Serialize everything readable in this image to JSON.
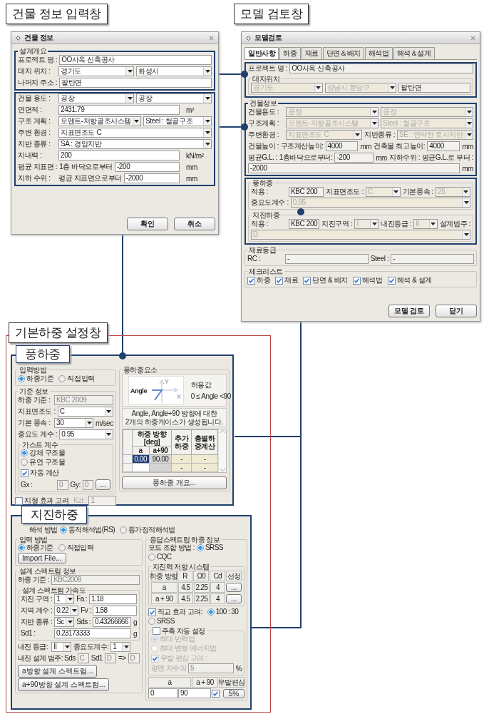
{
  "callouts": [
    "건물 정보 입력창",
    "모델 검토창"
  ],
  "building_window": {
    "title": "건물 정보",
    "blocks": [
      {
        "kind": "group",
        "legend": "설계개요",
        "highlighted": true,
        "blocks": [
          {
            "kind": "row",
            "items": [
              {
                "kind": "label",
                "text": "프로젝트 명 :"
              },
              {
                "kind": "input",
                "value": "OO사옥 신축공사"
              }
            ]
          },
          {
            "kind": "row",
            "items": [
              {
                "kind": "label",
                "text": "대지 위치 :"
              },
              {
                "kind": "select",
                "value": "경기도"
              },
              {
                "kind": "select",
                "value": "화성시"
              }
            ]
          },
          {
            "kind": "row",
            "items": [
              {
                "kind": "label",
                "text": "나머지 주소 :"
              },
              {
                "kind": "input",
                "value": "팔탄면"
              }
            ]
          }
        ]
      },
      {
        "kind": "group",
        "highlighted": true,
        "blocks": [
          {
            "kind": "row",
            "items": [
              {
                "kind": "label",
                "text": "건물 용도 :"
              },
              {
                "kind": "select",
                "value": "공장"
              },
              {
                "kind": "select",
                "value": "공장"
              }
            ]
          },
          {
            "kind": "row",
            "items": [
              {
                "kind": "label",
                "text": "연면적 :"
              },
              {
                "kind": "input",
                "value": "2431.79"
              },
              {
                "kind": "unit",
                "text": "m²"
              }
            ]
          },
          {
            "kind": "row",
            "items": [
              {
                "kind": "label",
                "text": "구조 계획 :"
              },
              {
                "kind": "select",
                "value": "모멘트-저항골조시스템"
              },
              {
                "kind": "select",
                "value": "Steel : 철골구조"
              }
            ]
          },
          {
            "kind": "row",
            "items": [
              {
                "kind": "label",
                "text": "주변 환경 :"
              },
              {
                "kind": "select",
                "value": "지표면조도 C"
              }
            ]
          },
          {
            "kind": "row",
            "items": [
              {
                "kind": "label",
                "text": "지반 종류 :"
              },
              {
                "kind": "select",
                "value": "SA : 경암지반"
              }
            ]
          },
          {
            "kind": "row",
            "items": [
              {
                "kind": "label",
                "text": "지내력 :"
              },
              {
                "kind": "input",
                "value": "200"
              },
              {
                "kind": "unit",
                "text": "kN/m²"
              }
            ]
          },
          {
            "kind": "row",
            "items": [
              {
                "kind": "label",
                "text": "평균 지표면 :"
              },
              {
                "kind": "label",
                "text": "1층 바닥으로부터"
              },
              {
                "kind": "input",
                "value": "-200"
              },
              {
                "kind": "unit",
                "text": "mm"
              }
            ]
          },
          {
            "kind": "row",
            "items": [
              {
                "kind": "label",
                "text": "지하 수위 :"
              },
              {
                "kind": "label",
                "text": "평균 지표면으로부터"
              },
              {
                "kind": "input",
                "value": "-2000"
              },
              {
                "kind": "unit",
                "text": "mm"
              }
            ]
          }
        ]
      }
    ],
    "buttons": [
      "확인",
      "취소"
    ]
  },
  "review_window": {
    "title": "모델검토",
    "tabs": [
      {
        "label": "일반사항",
        "selected": true
      },
      {
        "label": "하중",
        "selected": false
      },
      {
        "label": "재료",
        "selected": false
      },
      {
        "label": "단면＆배치",
        "selected": false
      },
      {
        "label": "해석법",
        "selected": false
      },
      {
        "label": "해석＆설계",
        "selected": false
      }
    ],
    "blocks": [
      {
        "kind": "group",
        "highlighted": true,
        "blocks": [
          {
            "kind": "row",
            "items": [
              {
                "kind": "label",
                "text": "프로젝트 명 :"
              },
              {
                "kind": "input",
                "value": "OO사옥 신축공사"
              }
            ]
          },
          {
            "kind": "group",
            "legend": "대지위치",
            "highlighted": false,
            "blocks": [
              {
                "kind": "row",
                "items": [
                  {
                    "kind": "select",
                    "value": "경기도",
                    "disabled": true
                  },
                  {
                    "kind": "select",
                    "value": "성남시 분당구",
                    "disabled": true
                  },
                  {
                    "kind": "input",
                    "value": "팔탄면"
                  }
                ]
              }
            ]
          }
        ]
      },
      {
        "kind": "group",
        "legend": "건물정보",
        "highlighted": true,
        "blocks": [
          {
            "kind": "row",
            "items": [
              {
                "kind": "label",
                "text": "건물용도 :"
              },
              {
                "kind": "select",
                "value": "공장",
                "disabled": true
              },
              {
                "kind": "select",
                "value": "공장",
                "disabled": true
              }
            ]
          },
          {
            "kind": "row",
            "items": [
              {
                "kind": "label",
                "text": "구조계획 :"
              },
              {
                "kind": "select",
                "value": "모멘트-저항골조시스템",
                "disabled": true
              },
              {
                "kind": "select",
                "value": "Steel : 철골구조",
                "disabled": true
              }
            ]
          },
          {
            "kind": "row",
            "items": [
              {
                "kind": "label",
                "text": "주변환경 :"
              },
              {
                "kind": "select",
                "value": "지표면조도 C",
                "disabled": true
              },
              {
                "kind": "label",
                "text": "지반종류 :"
              },
              {
                "kind": "select",
                "value": "SE : 연약한 토사지반",
                "disabled": true
              }
            ]
          },
          {
            "kind": "row",
            "items": [
              {
                "kind": "label",
                "text": "건물높이 : 구조계산높이:"
              },
              {
                "kind": "input",
                "value": "4000"
              },
              {
                "kind": "unit",
                "text": "mm"
              },
              {
                "kind": "label",
                "text": "건축물 최고높이:"
              },
              {
                "kind": "input",
                "value": "4000"
              },
              {
                "kind": "unit",
                "text": "mm"
              }
            ]
          },
          {
            "kind": "row",
            "items": [
              {
                "kind": "label",
                "text": "평균G.L. : 1층바닥으로부터:"
              },
              {
                "kind": "input",
                "value": "-200"
              },
              {
                "kind": "unit",
                "text": "mm"
              },
              {
                "kind": "label",
                "text": "지하수위 : 평균G.L.로 부터 :"
              },
              {
                "kind": "input",
                "value": "-2000"
              },
              {
                "kind": "unit",
                "text": "mm"
              }
            ]
          }
        ]
      },
      {
        "kind": "group",
        "highlighted": true,
        "blocks": [
          {
            "kind": "group",
            "legend": "풍하중",
            "highlighted": false,
            "blocks": [
              {
                "kind": "row",
                "items": [
                  {
                    "kind": "label",
                    "text": "적용 :"
                  },
                  {
                    "kind": "input",
                    "value": "KBC 200"
                  },
                  {
                    "kind": "label",
                    "text": "지표면조도 :"
                  },
                  {
                    "kind": "select",
                    "value": "C",
                    "disabled": true
                  },
                  {
                    "kind": "label",
                    "text": "기본풍속 :"
                  },
                  {
                    "kind": "select",
                    "value": "25",
                    "disabled": true
                  },
                  {
                    "kind": "label",
                    "text": "중요도계수 :"
                  },
                  {
                    "kind": "select",
                    "value": "0.95",
                    "disabled": true
                  }
                ]
              }
            ]
          },
          {
            "kind": "group",
            "legend": "지진하중",
            "highlighted": false,
            "blocks": [
              {
                "kind": "row",
                "items": [
                  {
                    "kind": "label",
                    "text": "적용 :"
                  },
                  {
                    "kind": "input",
                    "value": "KBC 200"
                  },
                  {
                    "kind": "label",
                    "text": "지진구역 :"
                  },
                  {
                    "kind": "select",
                    "value": "I",
                    "disabled": true
                  },
                  {
                    "kind": "label",
                    "text": "내진등급 :"
                  },
                  {
                    "kind": "select",
                    "value": "II",
                    "disabled": true
                  },
                  {
                    "kind": "label",
                    "text": "설계범주 :"
                  },
                  {
                    "kind": "select",
                    "value": "D",
                    "disabled": true
                  }
                ]
              }
            ]
          }
        ]
      },
      {
        "kind": "group",
        "legend": "재료등급",
        "highlighted": false,
        "blocks": [
          {
            "kind": "row",
            "items": [
              {
                "kind": "label",
                "text": "RC :"
              },
              {
                "kind": "input",
                "value": "-"
              },
              {
                "kind": "label",
                "text": "Steel :"
              },
              {
                "kind": "input",
                "value": "-"
              }
            ]
          }
        ]
      },
      {
        "kind": "group",
        "legend": "체크리스트",
        "highlighted": false,
        "blocks": [
          {
            "kind": "row",
            "items": [
              {
                "kind": "check",
                "text": "하중",
                "checked": true
              },
              {
                "kind": "check",
                "text": "재료",
                "checked": true
              },
              {
                "kind": "check",
                "text": "단면 & 배치",
                "checked": true
              },
              {
                "kind": "check",
                "text": "해석법",
                "checked": true
              },
              {
                "kind": "check",
                "text": "해석 & 설계",
                "checked": true
              }
            ]
          }
        ]
      }
    ],
    "buttons": [
      "모델 검토",
      "닫기"
    ]
  },
  "load_settings": {
    "label": "기본하중 설정창",
    "wind": {
      "label": "풍하중",
      "columns": [
        [
          {
            "kind": "group",
            "legend": "입력방법",
            "highlighted": false,
            "blocks": [
              {
                "kind": "row",
                "items": [
                  {
                    "kind": "radio",
                    "text": "하중기준",
                    "selected": true
                  },
                  {
                    "kind": "radio",
                    "text": "직접입력",
                    "selected": false
                  }
                ]
              }
            ]
          },
          {
            "kind": "group",
            "legend": "기준 정보",
            "highlighted": false,
            "blocks": [
              {
                "kind": "row",
                "items": [
                  {
                    "kind": "label",
                    "text": "하중 기준 :"
                  },
                  {
                    "kind": "input",
                    "value": "KBC 2009",
                    "disabled": true
                  }
                ]
              },
              {
                "kind": "row",
                "items": [
                  {
                    "kind": "label",
                    "text": "지표면조도 :"
                  },
                  {
                    "kind": "select",
                    "value": "C"
                  }
                ]
              },
              {
                "kind": "row",
                "items": [
                  {
                    "kind": "label",
                    "text": "기본 풍속 :"
                  },
                  {
                    "kind": "select",
                    "value": "30"
                  },
                  {
                    "kind": "unit",
                    "text": "m/sec"
                  }
                ]
              },
              {
                "kind": "row",
                "items": [
                  {
                    "kind": "label",
                    "text": "중요도 계수 :"
                  },
                  {
                    "kind": "select",
                    "value": "0.95"
                  }
                ]
              },
              {
                "kind": "group",
                "legend": "가스트 계수",
                "highlighted": false,
                "blocks": [
                  {
                    "kind": "row",
                    "items": [
                      {
                        "kind": "radio",
                        "text": "강체 구조물",
                        "selected": true
                      },
                      {
                        "kind": "radio",
                        "text": "유연 구조물",
                        "selected": false
                      }
                    ]
                  },
                  {
                    "kind": "row",
                    "items": [
                      {
                        "kind": "check",
                        "text": "자동 계산",
                        "checked": true
                      }
                    ]
                  },
                  {
                    "kind": "row",
                    "items": [
                      {
                        "kind": "label",
                        "text": "Gx :"
                      },
                      {
                        "kind": "input",
                        "value": "0",
                        "disabled": true
                      },
                      {
                        "kind": "label",
                        "text": "Gy:"
                      },
                      {
                        "kind": "input",
                        "value": "0",
                        "disabled": true
                      },
                      {
                        "kind": "button",
                        "text": "..."
                      }
                    ]
                  }
                ]
              }
            ]
          },
          {
            "kind": "row",
            "items": [
              {
                "kind": "check",
                "text": "지형 효과 고려",
                "checked": false
              },
              {
                "kind": "label",
                "text": "Kzt :",
                "disabled": true
              },
              {
                "kind": "input",
                "value": "1",
                "disabled": true
              }
            ]
          }
        ],
        [
          {
            "kind": "group",
            "legend": "풍하중요소",
            "highlighted": false,
            "blocks": [
              {
                "kind": "angle_diagram",
                "angle_label": "Angle",
                "x_label": "X",
                "y_label": "Y",
                "title": "허용값",
                "range": "0 ≤ Angle <90"
              },
              {
                "kind": "note",
                "text": "Angle, Angle+90 방향에 대한\n2개의 하중케이스가 생성됩니다."
              },
              {
                "kind": "wind_table",
                "header": "하중 방향 [deg]",
                "subheaders": [
                  "a",
                  "a+90"
                ],
                "extra_headers": [
                  "추가하중",
                  "층별하중계산"
                ],
                "rows": [
                  {
                    "direction": "0.00",
                    "direction_90": "90.00",
                    "extra": [
                      "-",
                      "-"
                    ],
                    "selected": true
                  },
                  {
                    "extra": [
                      "-",
                      "-"
                    ],
                    "selected": false
                  }
                ]
              },
              {
                "kind": "wide_button",
                "text": "풍하중 개요..."
              }
            ]
          }
        ]
      ]
    },
    "seismic": {
      "label": "지진하중",
      "top_row": [
        {
          "kind": "label",
          "text": "해석 방법"
        },
        {
          "kind": "radio",
          "text": "동적해석법(RS)",
          "selected": true
        },
        {
          "kind": "radio",
          "text": "등가정적해석법",
          "selected": false
        }
      ],
      "columns": [
        [
          {
            "kind": "group",
            "legend": "입력 방법",
            "highlighted": false,
            "blocks": [
              {
                "kind": "row",
                "items": [
                  {
                    "kind": "radio",
                    "text": "하중기준",
                    "selected": true
                  },
                  {
                    "kind": "radio",
                    "text": "직접입력",
                    "selected": false
                  },
                  {
                    "kind": "button",
                    "text": "Import File..."
                  }
                ]
              }
            ]
          },
          {
            "kind": "group",
            "legend": "설계 스펙트럼 정보",
            "highlighted": false,
            "blocks": [
              {
                "kind": "row",
                "items": [
                  {
                    "kind": "label",
                    "text": "하중 기준 :"
                  },
                  {
                    "kind": "input",
                    "value": "KBC2009",
                    "disabled": true
                  }
                ]
              },
              {
                "kind": "group",
                "legend": "설계 스펙트럼 가속도",
                "highlighted": false,
                "blocks": [
                  {
                    "kind": "row",
                    "items": [
                      {
                        "kind": "label",
                        "text": "지진 구역 :"
                      },
                      {
                        "kind": "select",
                        "value": "1"
                      },
                      {
                        "kind": "label",
                        "text": "Fa :"
                      },
                      {
                        "kind": "input",
                        "value": "1.18"
                      }
                    ]
                  },
                  {
                    "kind": "row",
                    "items": [
                      {
                        "kind": "label",
                        "text": "지역 계수 :"
                      },
                      {
                        "kind": "select",
                        "value": "0.22"
                      },
                      {
                        "kind": "label",
                        "text": "Fv :"
                      },
                      {
                        "kind": "input",
                        "value": "1.58"
                      }
                    ]
                  },
                  {
                    "kind": "row",
                    "items": [
                      {
                        "kind": "label",
                        "text": "지반 종류 :"
                      },
                      {
                        "kind": "select",
                        "value": "Sc"
                      },
                      {
                        "kind": "label",
                        "text": "Sds :"
                      },
                      {
                        "kind": "input",
                        "value": "0.43266666"
                      },
                      {
                        "kind": "unit",
                        "text": "g"
                      }
                    ]
                  },
                  {
                    "kind": "row",
                    "items": [
                      {
                        "kind": "label",
                        "text": "Sd1 :"
                      },
                      {
                        "kind": "input",
                        "value": "0.23173333"
                      },
                      {
                        "kind": "unit",
                        "text": "g"
                      }
                    ]
                  }
                ]
              },
              {
                "kind": "row",
                "items": [
                  {
                    "kind": "label",
                    "text": "내진 등급:"
                  },
                  {
                    "kind": "select",
                    "value": "II"
                  },
                  {
                    "kind": "label",
                    "text": "중요도계수:"
                  },
                  {
                    "kind": "select",
                    "value": "1"
                  }
                ]
              },
              {
                "kind": "row",
                "items": [
                  {
                    "kind": "label",
                    "text": "내진 설계 범주: Sds"
                  },
                  {
                    "kind": "input",
                    "value": "C",
                    "disabled": true
                  },
                  {
                    "kind": "label",
                    "text": "Sd1"
                  },
                  {
                    "kind": "input",
                    "value": "D",
                    "disabled": true
                  },
                  {
                    "kind": "label",
                    "text": "=>"
                  },
                  {
                    "kind": "input",
                    "value": "D",
                    "disabled": true
                  }
                ]
              },
              {
                "kind": "row",
                "items": [
                  {
                    "kind": "button",
                    "text": "a방향 설계 스펙트럼..."
                  },
                  {
                    "kind": "button",
                    "text": "a+90방향 설계 스펙트럼..."
                  }
                ]
              }
            ]
          }
        ],
        [
          {
            "kind": "group",
            "legend": "응답스펙트럼 하중 정보",
            "highlighted": false,
            "blocks": [
              {
                "kind": "row",
                "items": [
                  {
                    "kind": "label",
                    "text": "모드 조합 방법 :"
                  },
                  {
                    "kind": "radio",
                    "text": "SRSS",
                    "selected": true
                  },
                  {
                    "kind": "radio",
                    "text": "CQC",
                    "selected": false
                  }
                ]
              },
              {
                "kind": "group",
                "legend": "지진력 저항 시스템",
                "highlighted": false,
                "blocks": [
                  {
                    "kind": "grid_table",
                    "columns": [
                      "하중 방향",
                      "R",
                      "Ω0",
                      "Cd",
                      "선정"
                    ],
                    "rows": [
                      [
                        {
                          "kind": "label",
                          "text": "a"
                        },
                        {
                          "kind": "label",
                          "text": "4.5"
                        },
                        {
                          "kind": "label",
                          "text": "2.25"
                        },
                        {
                          "kind": "label",
                          "text": "4"
                        },
                        {
                          "kind": "button",
                          "text": "..."
                        }
                      ],
                      [
                        {
                          "kind": "label",
                          "text": "a + 90"
                        },
                        {
                          "kind": "label",
                          "text": "4.5"
                        },
                        {
                          "kind": "label",
                          "text": "2.25"
                        },
                        {
                          "kind": "label",
                          "text": "4"
                        },
                        {
                          "kind": "button",
                          "text": "..."
                        }
                      ]
                    ]
                  }
                ]
              },
              {
                "kind": "row",
                "items": [
                  {
                    "kind": "check",
                    "text": "직교 효과 고려:",
                    "checked": true
                  },
                  {
                    "kind": "radio",
                    "text": "100 : 30",
                    "selected": true
                  },
                  {
                    "kind": "radio",
                    "text": "SRSS",
                    "selected": false
                  }
                ]
              },
              {
                "kind": "group",
                "legend_check": {
                  "text": "주축 자동 설정",
                  "checked": false
                },
                "highlighted": false,
                "blocks": [
                  {
                    "kind": "row",
                    "items": [
                      {
                        "kind": "radio",
                        "text": "최대 반력법",
                        "selected": true,
                        "disabled": true
                      },
                      {
                        "kind": "radio",
                        "text": "최대 변형 에너지법",
                        "selected": false,
                        "disabled": true
                      }
                    ]
                  },
                  {
                    "kind": "row",
                    "items": [
                      {
                        "kind": "check",
                        "text": "우발 편심 고려 :",
                        "checked": true,
                        "disabled": true
                      },
                      {
                        "kind": "label",
                        "text": "평면 치수의",
                        "disabled": true
                      },
                      {
                        "kind": "input",
                        "value": "5",
                        "disabled": true
                      },
                      {
                        "kind": "unit",
                        "text": "%"
                      }
                    ]
                  }
                ]
              },
              {
                "kind": "grid_table",
                "columns": [
                  "a",
                  "a + 90",
                  "우발편심"
                ],
                "rows": [
                  [
                    {
                      "kind": "input",
                      "value": "0"
                    },
                    {
                      "kind": "input",
                      "value": "90"
                    },
                    {
                      "kind": "check",
                      "checked": true
                    },
                    {
                      "kind": "button",
                      "text": "5%"
                    }
                  ]
                ]
              }
            ]
          }
        ]
      ]
    }
  }
}
